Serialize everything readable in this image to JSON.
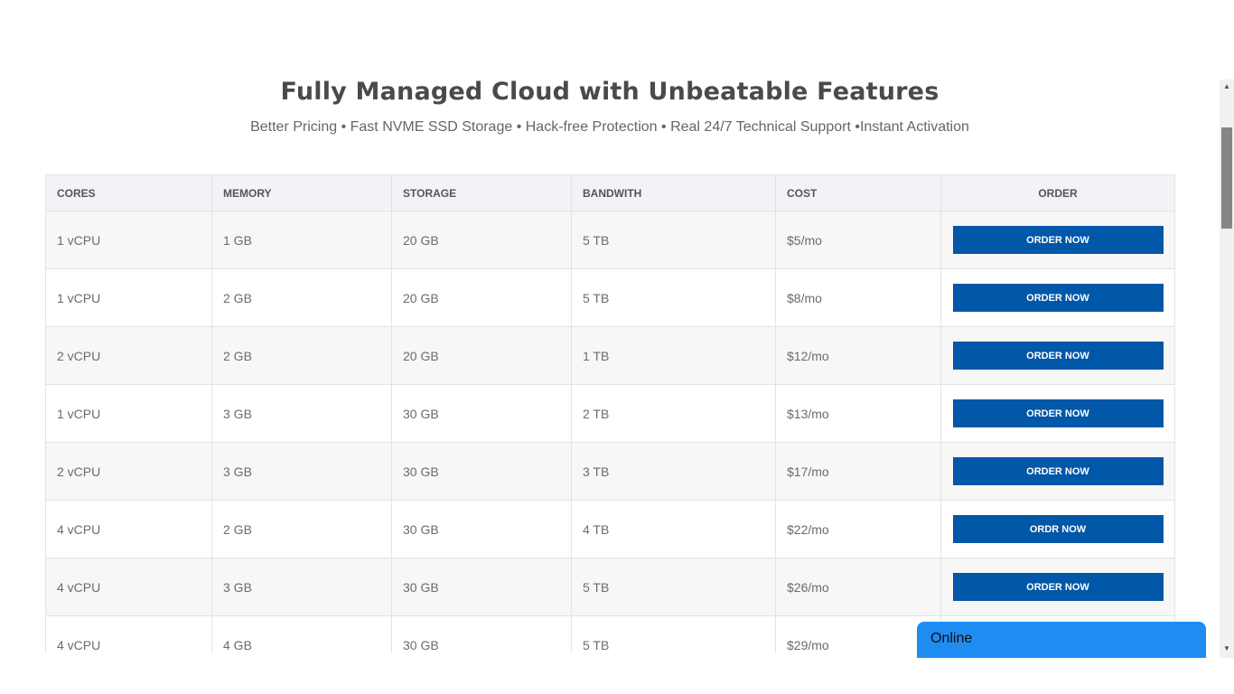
{
  "header": {
    "title": "Fully Managed Cloud with Unbeatable Features",
    "subtitle": "Better Pricing • Fast NVME SSD Storage • Hack-free Protection • Real 24/7 Technical Support •Instant Activation"
  },
  "table": {
    "columns": [
      "CORES",
      "MEMORY",
      "STORAGE",
      "BANDWITH",
      "COST",
      "ORDER"
    ],
    "rows": [
      {
        "cores": "1 vCPU",
        "memory": "1 GB",
        "storage": "20 GB",
        "bandwidth": "5 TB",
        "cost": "$5/mo",
        "button": "ORDER NOW"
      },
      {
        "cores": "1 vCPU",
        "memory": "2 GB",
        "storage": "20 GB",
        "bandwidth": "5 TB",
        "cost": "$8/mo",
        "button": "ORDER NOW"
      },
      {
        "cores": "2 vCPU",
        "memory": "2 GB",
        "storage": "20 GB",
        "bandwidth": "1 TB",
        "cost": "$12/mo",
        "button": "ORDER NOW"
      },
      {
        "cores": "1 vCPU",
        "memory": "3 GB",
        "storage": "30 GB",
        "bandwidth": "2 TB",
        "cost": "$13/mo",
        "button": "ORDER NOW"
      },
      {
        "cores": "2 vCPU",
        "memory": "3 GB",
        "storage": "30 GB",
        "bandwidth": "3 TB",
        "cost": "$17/mo",
        "button": "ORDER NOW"
      },
      {
        "cores": "4 vCPU",
        "memory": "2 GB",
        "storage": "30 GB",
        "bandwidth": "4 TB",
        "cost": "$22/mo",
        "button": "ORDR NOW"
      },
      {
        "cores": "4 vCPU",
        "memory": "3 GB",
        "storage": "30 GB",
        "bandwidth": "5 TB",
        "cost": "$26/mo",
        "button": "ORDER NOW"
      },
      {
        "cores": "4 vCPU",
        "memory": "4 GB",
        "storage": "30 GB",
        "bandwidth": "5 TB",
        "cost": "$29/mo",
        "button": ""
      }
    ]
  },
  "chat": {
    "status": "Online"
  },
  "colors": {
    "button": "#0157a8",
    "chat": "#1e8cf0",
    "header_bg": "#f2f3f6"
  },
  "icons": {
    "scroll_up": "scroll-up-arrow-icon",
    "scroll_down": "scroll-down-arrow-icon"
  }
}
